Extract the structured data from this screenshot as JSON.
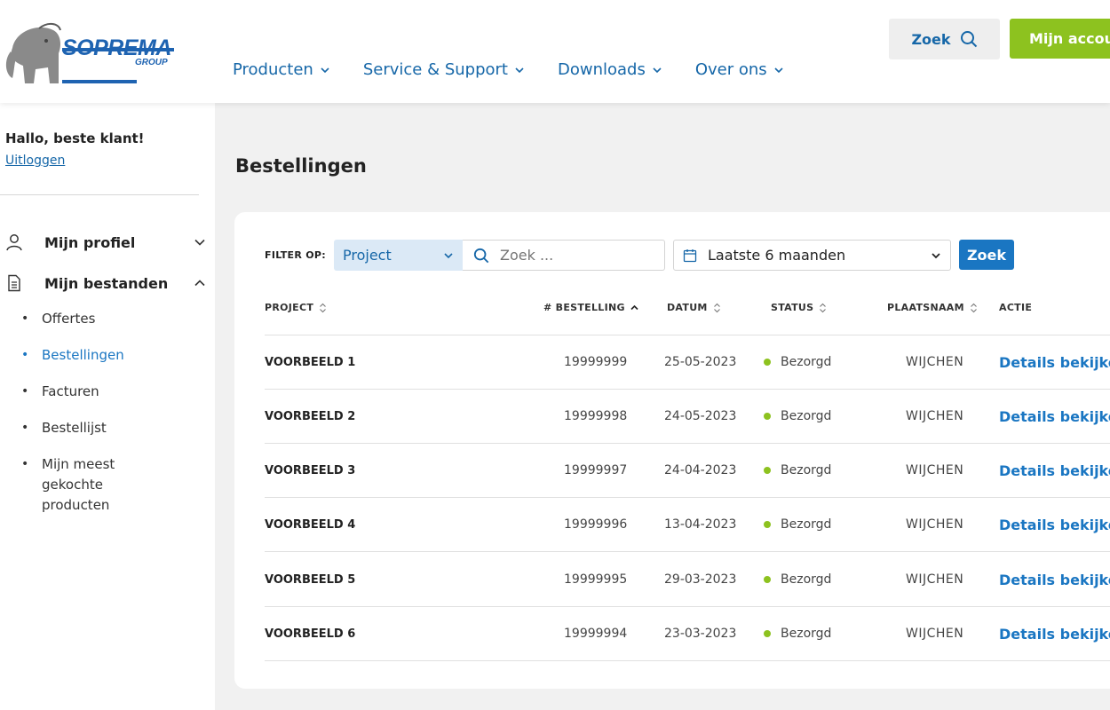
{
  "header": {
    "logo_text": "SOPREMA",
    "logo_subtext": "GROUP",
    "nav": [
      {
        "label": "Producten"
      },
      {
        "label": "Service & Support"
      },
      {
        "label": "Downloads"
      },
      {
        "label": "Over ons"
      }
    ],
    "search_label": "Zoek",
    "account_label": "Mijn account"
  },
  "sidebar": {
    "greeting": "Hallo, beste klant!",
    "logout": "Uitloggen",
    "sections": [
      {
        "label": "Mijn profiel",
        "icon": "person-icon",
        "expanded": false
      },
      {
        "label": "Mijn bestanden",
        "icon": "document-icon",
        "expanded": true
      }
    ],
    "sub_items": [
      {
        "label": "Offertes"
      },
      {
        "label": "Bestellingen",
        "active": true
      },
      {
        "label": "Facturen"
      },
      {
        "label": "Bestellijst"
      },
      {
        "label": "Mijn meest gekochte producten"
      }
    ]
  },
  "main": {
    "title": "Bestellingen",
    "filter": {
      "label": "FILTER OP:",
      "field_value": "Project",
      "search_placeholder": "Zoek ...",
      "date_value": "Laatste 6 maanden",
      "button_label": "Zoek"
    },
    "columns": [
      "PROJECT",
      "# BESTELLING",
      "DATUM",
      "STATUS",
      "PLAATSNAAM",
      "ACTIE"
    ],
    "rows": [
      {
        "project": "VOORBEELD 1",
        "order": "19999999",
        "date": "25-05-2023",
        "status": "Bezorgd",
        "place": "WIJCHEN",
        "action": "Details bekijken"
      },
      {
        "project": "VOORBEELD 2",
        "order": "19999998",
        "date": "24-05-2023",
        "status": "Bezorgd",
        "place": "WIJCHEN",
        "action": "Details bekijken"
      },
      {
        "project": "VOORBEELD 3",
        "order": "19999997",
        "date": "24-04-2023",
        "status": "Bezorgd",
        "place": "WIJCHEN",
        "action": "Details bekijken"
      },
      {
        "project": "VOORBEELD 4",
        "order": "19999996",
        "date": "13-04-2023",
        "status": "Bezorgd",
        "place": "WIJCHEN",
        "action": "Details bekijken"
      },
      {
        "project": "VOORBEELD 5",
        "order": "19999995",
        "date": "29-03-2023",
        "status": "Bezorgd",
        "place": "WIJCHEN",
        "action": "Details bekijken"
      },
      {
        "project": "VOORBEELD 6",
        "order": "19999994",
        "date": "23-03-2023",
        "status": "Bezorgd",
        "place": "WIJCHEN",
        "action": "Details bekijken"
      }
    ]
  },
  "colors": {
    "brand_blue": "#1667a8",
    "link_blue": "#1a76c2",
    "accent_green": "#8dc21f",
    "status_green": "#8dc21f"
  }
}
